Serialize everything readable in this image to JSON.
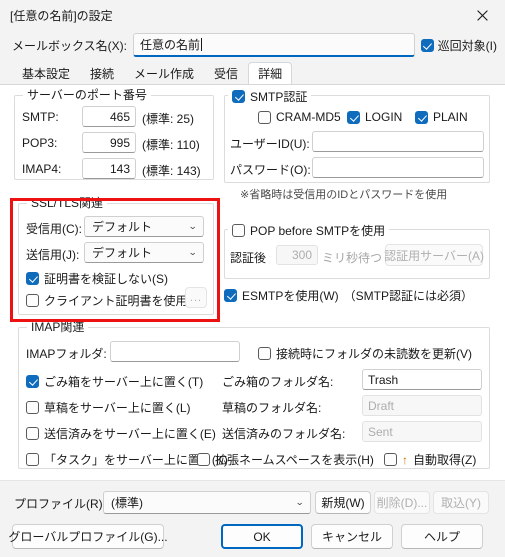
{
  "window": {
    "title": "[任意の名前]の設定",
    "close_icon": "close-icon"
  },
  "mailbox": {
    "label": "メールボックス名(X):",
    "value": "任意の名前",
    "patrol_label": "巡回対象(I)",
    "patrol_checked": true
  },
  "tabs": [
    {
      "label": "基本設定",
      "active": false
    },
    {
      "label": "接続",
      "active": false
    },
    {
      "label": "メール作成",
      "active": false
    },
    {
      "label": "受信",
      "active": false
    },
    {
      "label": "詳細",
      "active": true
    }
  ],
  "port_group": {
    "title": "サーバーのポート番号",
    "rows": [
      {
        "label": "SMTP:",
        "value": "465",
        "hint": "(標準: 25)"
      },
      {
        "label": "POP3:",
        "value": "995",
        "hint": "(標準: 110)"
      },
      {
        "label": "IMAP4:",
        "value": "143",
        "hint": "(標準: 143)"
      }
    ]
  },
  "smtp_auth": {
    "title": "SMTP認証",
    "checked": true,
    "methods": [
      {
        "label": "CRAM-MD5",
        "checked": false
      },
      {
        "label": "LOGIN",
        "checked": true
      },
      {
        "label": "PLAIN",
        "checked": true
      }
    ],
    "userid_label": "ユーザーID(U):",
    "userid_value": "",
    "password_label": "パスワード(O):",
    "password_value": "",
    "note": "※省略時は受信用のIDとパスワードを使用"
  },
  "ssl_group": {
    "title": "SSL/TLS関連",
    "highlighted": true,
    "highlight_color": "#ee1111",
    "receive_label": "受信用(C):",
    "receive_value": "デフォルト",
    "send_label": "送信用(J):",
    "send_value": "デフォルト",
    "no_verify_label": "証明書を検証しない(S)",
    "no_verify_checked": true,
    "client_cert_label": "クライアント証明書を使用(F)",
    "client_cert_checked": false,
    "browse_label": "...",
    "browse_disabled": true
  },
  "pop_before_smtp": {
    "title": "POP before SMTPを使用",
    "checked": false,
    "after_auth_label": "認証後",
    "wait_value": "300",
    "wait_unit": "ミリ秒待つ",
    "auth_server_button": "認証用サーバー(A)",
    "disabled": true
  },
  "esmtp": {
    "label": "ESMTPを使用(W)",
    "note": "（SMTP認証には必須）",
    "checked": true
  },
  "imap_group": {
    "title": "IMAP関連",
    "folder_label": "IMAPフォルダ:",
    "folder_value": "",
    "refresh_unread_label": "接続時にフォルダの未読数を更新(V)",
    "refresh_unread_checked": false,
    "rows": [
      {
        "check_label": "ごみ箱をサーバー上に置く(T)",
        "checked": true,
        "name_label": "ごみ箱のフォルダ名:",
        "name_value": "Trash",
        "disabled": false
      },
      {
        "check_label": "草稿をサーバー上に置く(L)",
        "checked": false,
        "name_label": "草稿のフォルダ名:",
        "name_value": "Draft",
        "disabled": true
      },
      {
        "check_label": "送信済みをサーバー上に置く(E)",
        "checked": false,
        "name_label": "送信済みのフォルダ名:",
        "name_value": "Sent",
        "disabled": true
      }
    ],
    "task_label": "「タスク」をサーバー上に置く(K)",
    "task_checked": false,
    "namespace_label": "拡張ネームスペースを表示(H)",
    "namespace_checked": false,
    "auto_get_label": "自動取得(Z)",
    "auto_get_checked": false,
    "auto_get_arrow": "↑"
  },
  "profile": {
    "label": "プロファイル(R):",
    "value": "(標準)",
    "new_button": "新規(W)",
    "delete_button": "削除(D)...",
    "import_button": "取込(Y)",
    "delete_disabled": true,
    "import_disabled": true
  },
  "footer_buttons": {
    "global_profile": "グローバルプロファイル(G)...",
    "ok": "OK",
    "cancel": "キャンセル",
    "help": "ヘルプ"
  }
}
